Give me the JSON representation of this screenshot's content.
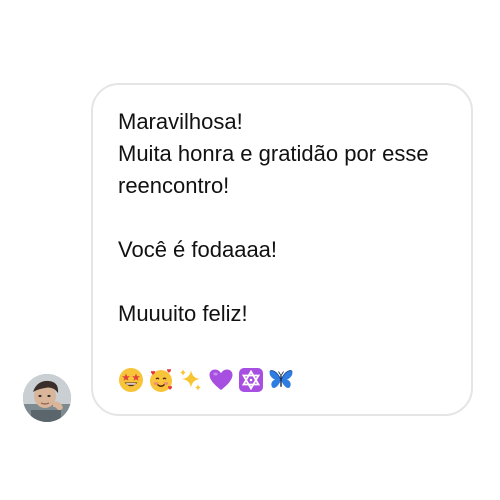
{
  "message": {
    "lines": [
      "Maravilhosa!",
      "Muita honra e gratidão por esse",
      "reencontro!",
      "",
      "Você é fodaaaa!",
      "",
      "Muuuito feliz!"
    ],
    "emojis": [
      "star-struck-emoji",
      "smiling-face-with-hearts-emoji",
      "sparkles-emoji",
      "purple-heart-emoji",
      "star-of-david-emoji",
      "butterfly-emoji"
    ]
  },
  "colors": {
    "bubble_border": "#e5e5e5",
    "text": "#111111",
    "purple": "#a64fe0",
    "butterfly": "#2f7de1"
  }
}
